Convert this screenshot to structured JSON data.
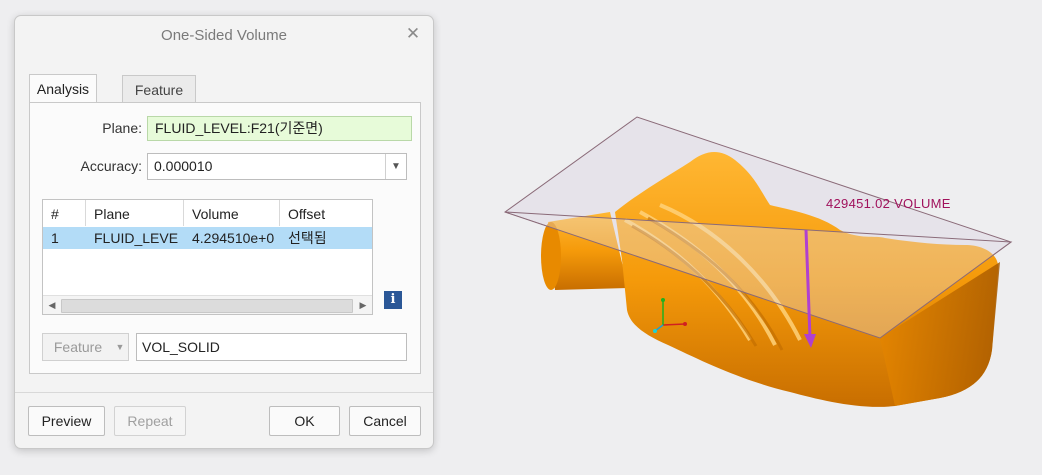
{
  "dialog": {
    "title": "One-Sided Volume",
    "tabs": [
      {
        "label": "Analysis",
        "active": true
      },
      {
        "label": "Feature",
        "active": false
      }
    ],
    "plane_label": "Plane:",
    "plane_value": "FLUID_LEVEL:F21(기준면)",
    "accuracy_label": "Accuracy:",
    "accuracy_value": "0.000010",
    "table": {
      "columns": [
        "#",
        "Plane",
        "Volume",
        "Offset"
      ],
      "rows": [
        {
          "num": "1",
          "plane": "FLUID_LEVEL",
          "volume": "4.294510e+0",
          "offset": "선택됨"
        }
      ]
    },
    "feature_button": "Feature",
    "feature_name": "VOL_SOLID",
    "buttons": {
      "preview": "Preview",
      "repeat": "Repeat",
      "ok": "OK",
      "cancel": "Cancel"
    }
  },
  "viewport": {
    "volume_annotation": "429451.02 VOLUME",
    "model_color": "#f59a0a",
    "annotation_color": "#a0115c",
    "arrow_color": "#b040d0"
  }
}
